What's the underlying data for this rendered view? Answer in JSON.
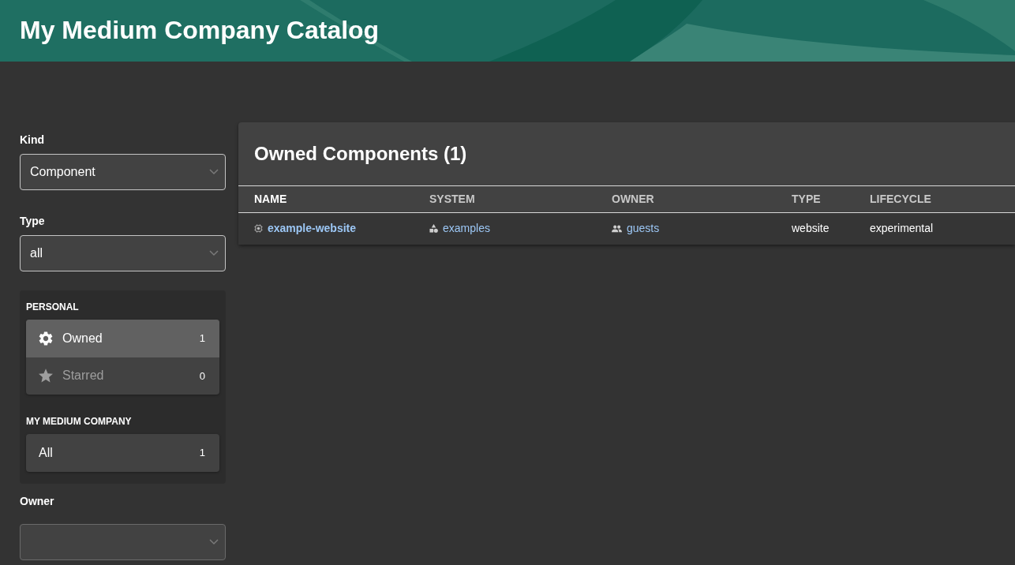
{
  "header": {
    "title": "My Medium Company Catalog"
  },
  "filters": {
    "kind": {
      "label": "Kind",
      "value": "Component"
    },
    "type": {
      "label": "Type",
      "value": "all"
    },
    "groups": [
      {
        "heading": "PERSONAL",
        "items": [
          {
            "kind": "owned",
            "label": "Owned",
            "count": "1",
            "selected": true,
            "disabled": false
          },
          {
            "kind": "starred",
            "label": "Starred",
            "count": "0",
            "selected": false,
            "disabled": true
          }
        ]
      },
      {
        "heading": "MY MEDIUM COMPANY",
        "items": [
          {
            "kind": "all",
            "label": "All",
            "count": "1",
            "selected": false,
            "disabled": false
          }
        ]
      }
    ],
    "owner": {
      "label": "Owner",
      "disabled": true
    }
  },
  "table": {
    "title": "Owned Components (1)",
    "columns": [
      {
        "label": "NAME",
        "sorted": true
      },
      {
        "label": "SYSTEM",
        "sorted": false
      },
      {
        "label": "OWNER",
        "sorted": false
      },
      {
        "label": "TYPE",
        "sorted": false
      },
      {
        "label": "LIFECYCLE",
        "sorted": false
      }
    ],
    "rows": [
      {
        "cells": [
          {
            "kind": "component",
            "text": "example-website"
          },
          {
            "kind": "system",
            "text": "examples"
          },
          {
            "kind": "group",
            "text": "guests"
          },
          {
            "kind": "plain",
            "text": "website"
          },
          {
            "kind": "plain",
            "text": "experimental"
          }
        ]
      }
    ]
  }
}
